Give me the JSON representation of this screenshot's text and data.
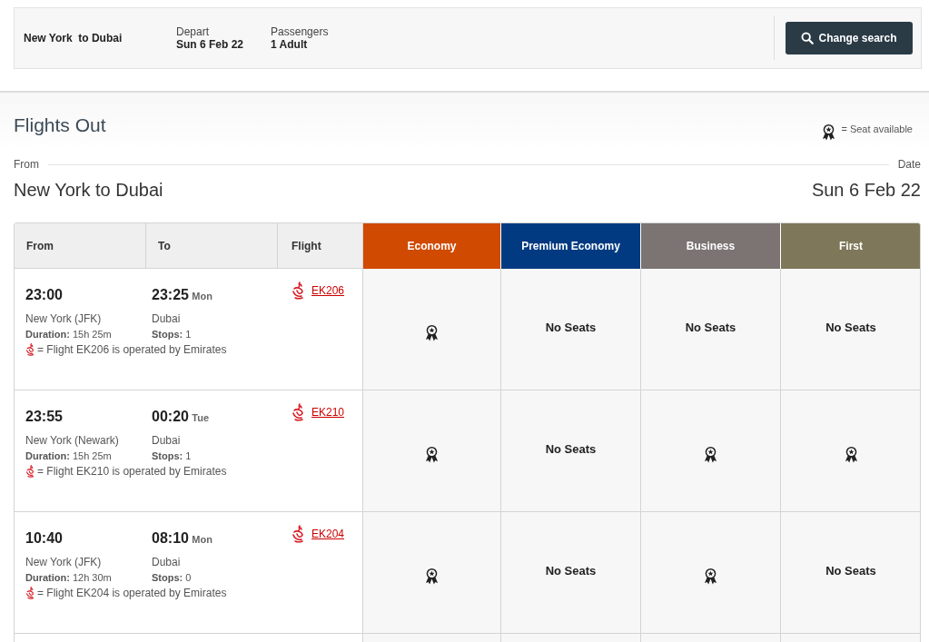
{
  "summary": {
    "route": "New York  to Dubai",
    "fields": [
      {
        "label": "Depart",
        "value": "Sun 6 Feb 22"
      },
      {
        "label": "Passengers",
        "value": "1 Adult"
      }
    ],
    "button": "Change search"
  },
  "section": {
    "title": "Flights Out",
    "legend": "= Seat available",
    "from_label": "From",
    "date_label": "Date",
    "route": "New York to Dubai",
    "date": "Sun 6 Feb 22"
  },
  "table": {
    "columns": [
      "From",
      "To",
      "Flight"
    ],
    "cabins": [
      {
        "label": "Economy",
        "color": "#d04a02"
      },
      {
        "label": "Premium Economy",
        "color": "#013a81"
      },
      {
        "label": "Business",
        "color": "#7b7473"
      },
      {
        "label": "First",
        "color": "#7e7759"
      }
    ],
    "rows": [
      {
        "depart": "23:00",
        "arrive": "23:25",
        "arrive_day": "Mon",
        "flight": "EK206",
        "origin": "New York (JFK)",
        "destination": "Dubai",
        "duration_label": "Duration:",
        "duration": "15h 25m",
        "stops_label": "Stops:",
        "stops": "1",
        "note": "= Flight EK206 is operated by Emirates",
        "cells": [
          {
            "kind": "seat"
          },
          {
            "kind": "text",
            "label": "No Seats"
          },
          {
            "kind": "text",
            "label": "No Seats"
          },
          {
            "kind": "text",
            "label": "No Seats"
          }
        ]
      },
      {
        "depart": "23:55",
        "arrive": "00:20",
        "arrive_day": "Tue",
        "flight": "EK210",
        "origin": "New York (Newark)",
        "destination": "Dubai",
        "duration_label": "Duration:",
        "duration": "15h 25m",
        "stops_label": "Stops:",
        "stops": "1",
        "note": "= Flight EK210 is operated by Emirates",
        "cells": [
          {
            "kind": "seat"
          },
          {
            "kind": "text",
            "label": "No Seats"
          },
          {
            "kind": "seat"
          },
          {
            "kind": "seat"
          }
        ]
      },
      {
        "depart": "10:40",
        "arrive": "08:10",
        "arrive_day": "Mon",
        "flight": "EK204",
        "origin": "New York (JFK)",
        "destination": "Dubai",
        "duration_label": "Duration:",
        "duration": "12h 30m",
        "stops_label": "Stops:",
        "stops": "0",
        "note": "= Flight EK204 is operated by Emirates",
        "cells": [
          {
            "kind": "seat"
          },
          {
            "kind": "text",
            "label": "No Seats"
          },
          {
            "kind": "seat"
          },
          {
            "kind": "text",
            "label": "No Seats"
          }
        ]
      }
    ]
  }
}
